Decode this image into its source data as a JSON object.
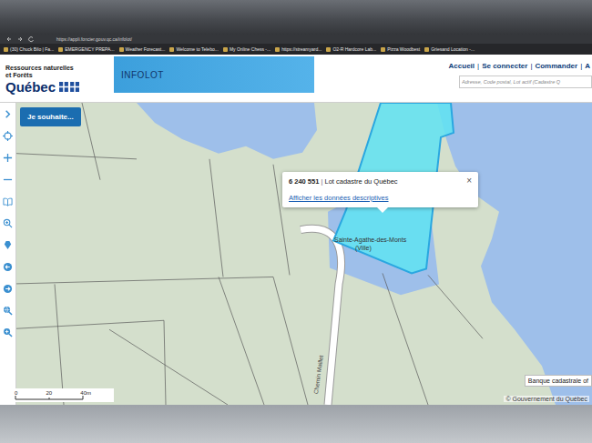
{
  "browser": {
    "url": "https://appli.foncier.gouv.qc.ca/infolot/",
    "bookmarks": [
      "(30) Chuck Bilo | Fa...",
      "EMERGENCY PREPA...",
      "Weather Forecast...",
      "Welcome to Telebo...",
      "My Online Chess -...",
      "https://streamyard...",
      "O2-R Hardcore Lab...",
      "Pizza Woodbest",
      "Griesand Location -..."
    ]
  },
  "header": {
    "ministry": [
      "Ressources naturelles",
      "et Forêts"
    ],
    "logo": "Québec",
    "app_title": "INFOLOT",
    "nav": {
      "links": [
        "Accueil",
        "Se connecter",
        "Commander",
        "A"
      ],
      "separator": "|"
    },
    "search": {
      "placeholder": "Adresse, Code postal, Lot actif (Cadastre Q"
    }
  },
  "map": {
    "action_button": "Je souhaite...",
    "place_labels": [
      "Sainte-Agathe-des-Monts",
      "(Ville)"
    ],
    "road_label": "Chemin Maillet",
    "popup": {
      "lot_number": "6 240 551",
      "separator": "|",
      "lot_type": "Lot cadastre du Québec",
      "close": "×",
      "link": "Afficher les données descriptives"
    },
    "scale": {
      "ticks": [
        "0",
        "20",
        "40m"
      ]
    },
    "source_tag": "Banque cadastrale of",
    "copyright": "© Gouvernement du Québec"
  }
}
